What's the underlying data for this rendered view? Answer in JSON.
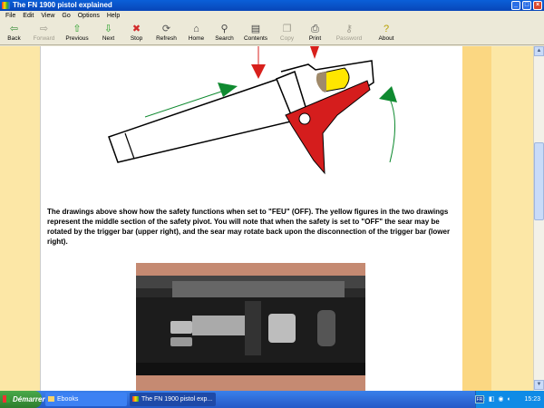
{
  "window": {
    "title": "The FN 1900 pistol explained"
  },
  "menu": [
    "File",
    "Edit",
    "View",
    "Go",
    "Options",
    "Help"
  ],
  "toolbar": [
    {
      "label": "Back",
      "icon": "back-arrow-icon",
      "glyph": "⇦",
      "color": "#3a8f3a",
      "enabled": true
    },
    {
      "label": "Forward",
      "icon": "forward-arrow-icon",
      "glyph": "⇨",
      "color": "#a09d8f",
      "enabled": false
    },
    {
      "label": "Previous",
      "icon": "up-arrow-icon",
      "glyph": "⇧",
      "color": "#2aa02a",
      "enabled": true
    },
    {
      "label": "Next",
      "icon": "down-arrow-icon",
      "glyph": "⇩",
      "color": "#2aa02a",
      "enabled": true
    },
    {
      "label": "Stop",
      "icon": "stop-icon",
      "glyph": "✖",
      "color": "#d12a2a",
      "enabled": true
    },
    {
      "label": "Refresh",
      "icon": "refresh-icon",
      "glyph": "⟳",
      "color": "#555555",
      "enabled": true
    },
    {
      "label": "Home",
      "icon": "home-icon",
      "glyph": "⌂",
      "color": "#444444",
      "enabled": true
    },
    {
      "label": "Search",
      "icon": "search-icon",
      "glyph": "⚲",
      "color": "#444444",
      "enabled": true
    },
    {
      "label": "Contents",
      "icon": "contents-icon",
      "glyph": "▤",
      "color": "#444444",
      "enabled": true
    },
    {
      "label": "Copy",
      "icon": "copy-icon",
      "glyph": "❐",
      "color": "#a09d8f",
      "enabled": false
    },
    {
      "label": "Print",
      "icon": "print-icon",
      "glyph": "⎙",
      "color": "#444444",
      "enabled": true
    },
    {
      "label": "Password",
      "icon": "key-icon",
      "glyph": "⚷",
      "color": "#a09d8f",
      "enabled": false
    },
    {
      "label": "About",
      "icon": "about-icon",
      "glyph": "?",
      "color": "#b8a000",
      "enabled": true
    }
  ],
  "content": {
    "description": "The drawings above show how the safety functions when set to \"FEU\" (OFF). The yellow figures in the two drawings represent the middle section of the safety pivot. You will note that when the safety is set to \"OFF\" the sear may be rotated by the trigger bar (upper right), and the sear may rotate back upon the disconnection of the trigger bar (lower right)."
  },
  "colors": {
    "arrow_red": "#d8201c",
    "arrow_green": "#0f8a30",
    "sear_red": "#d51d1d",
    "safety_yellow": "#ffe600",
    "margin_left": "#fce7a6",
    "margin_right": "#fbd782"
  },
  "taskbar": {
    "start_label": "Démarrer",
    "tasks": [
      {
        "label": "Ebooks",
        "icon": "folder-icon"
      },
      {
        "label": "The FN 1900 pistol exp...",
        "icon": "book-icon"
      }
    ],
    "lang": "FR",
    "clock": "15:23"
  }
}
